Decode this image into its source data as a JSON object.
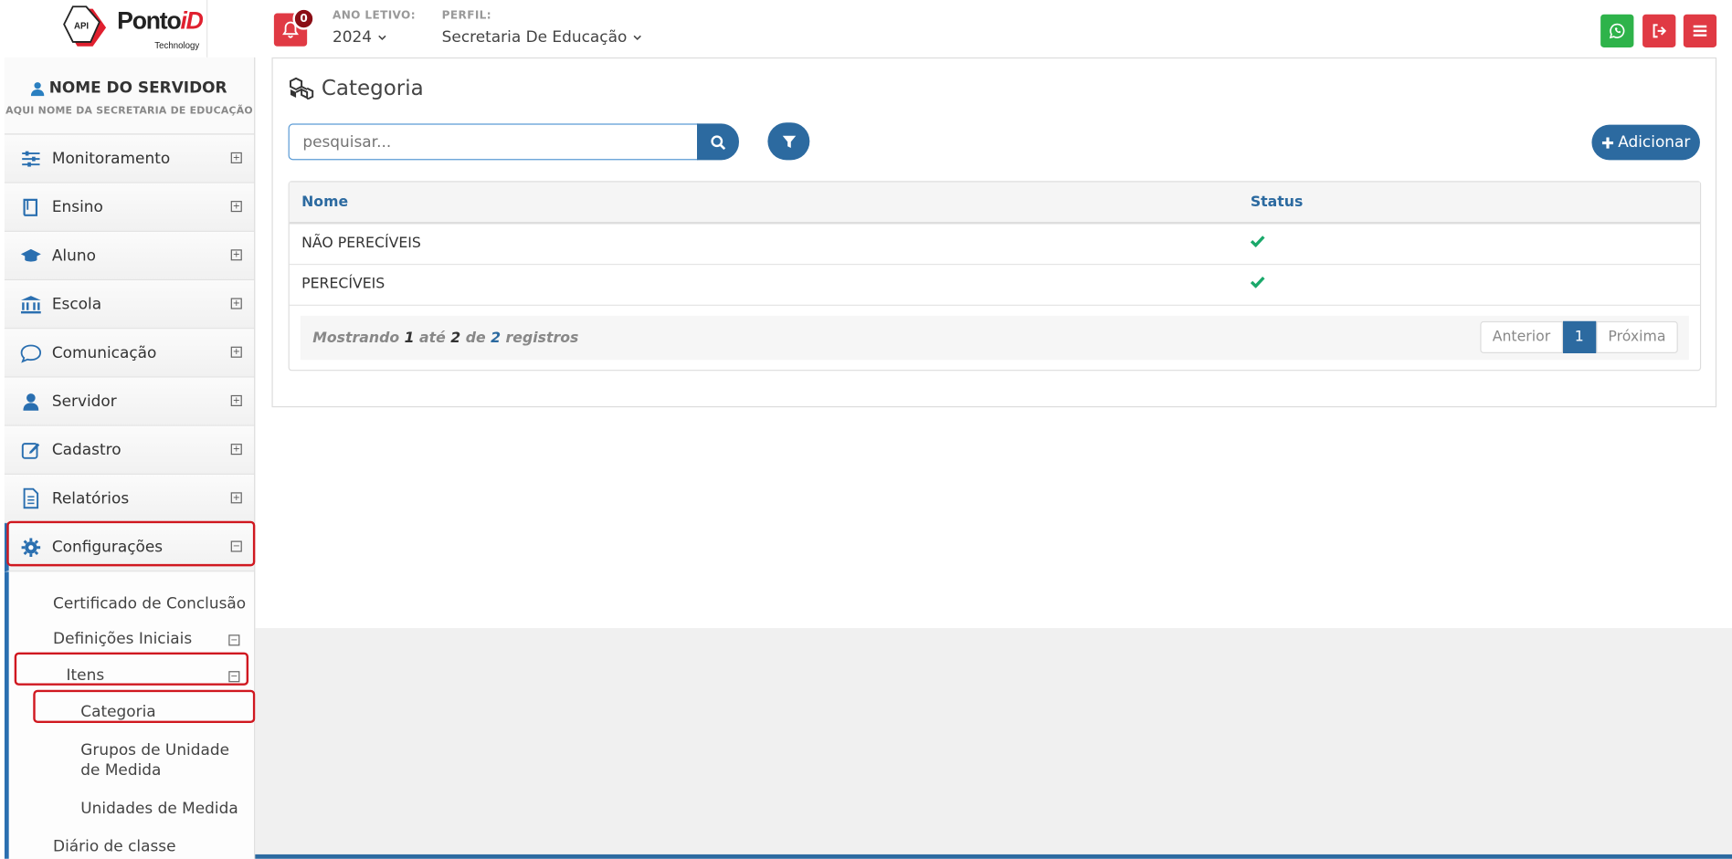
{
  "header": {
    "logo_text": "Ponto",
    "logo_text_id": "iD",
    "logo_sub": "Technology",
    "logo_badge": "API",
    "notifications_count": "0",
    "year_label": "ANO LETIVO:",
    "year_value": "2024",
    "profile_label": "PERFIL:",
    "profile_value": "Secretaria De Educação",
    "icons": [
      "whatsapp-icon",
      "logout-icon",
      "menu-icon"
    ],
    "colors": {
      "whatsapp": "#2eb34a",
      "danger": "#e03a44"
    }
  },
  "sidebar": {
    "user_name": "NOME DO SERVIDOR",
    "user_sub": "AQUI NOME DA SECRETARIA DE EDUCAÇÃO",
    "items": [
      {
        "label": "Monitoramento",
        "icon": "sliders-icon"
      },
      {
        "label": "Ensino",
        "icon": "book-icon"
      },
      {
        "label": "Aluno",
        "icon": "graduation-cap-icon"
      },
      {
        "label": "Escola",
        "icon": "bank-icon"
      },
      {
        "label": "Comunicação",
        "icon": "chat-icon"
      },
      {
        "label": "Servidor",
        "icon": "user-icon"
      },
      {
        "label": "Cadastro",
        "icon": "edit-icon"
      },
      {
        "label": "Relatórios",
        "icon": "document-icon"
      },
      {
        "label": "Configurações",
        "icon": "gear-icon"
      }
    ],
    "submenu": {
      "certificado": "Certificado de Conclusão",
      "definicoes": "Definições Iniciais",
      "itens": "Itens",
      "categoria": "Categoria",
      "grupos": "Grupos de Unidade de Medida",
      "unidades": "Unidades de Medida",
      "diario": "Diário de classe"
    }
  },
  "main": {
    "title": "Categoria",
    "search_placeholder": "pesquisar...",
    "add_label": "Adicionar",
    "table": {
      "columns": [
        "Nome",
        "Status"
      ],
      "rows": [
        {
          "nome": "NÃO PERECÍVEIS",
          "status": "active"
        },
        {
          "nome": "PERECÍVEIS",
          "status": "active"
        }
      ]
    },
    "pager": {
      "prefix": "Mostrando",
      "from": "1",
      "until_word": "até",
      "to": "2",
      "of_word": "de",
      "total": "2",
      "suffix": "registros",
      "prev": "Anterior",
      "page": "1",
      "next": "Próxima"
    }
  }
}
